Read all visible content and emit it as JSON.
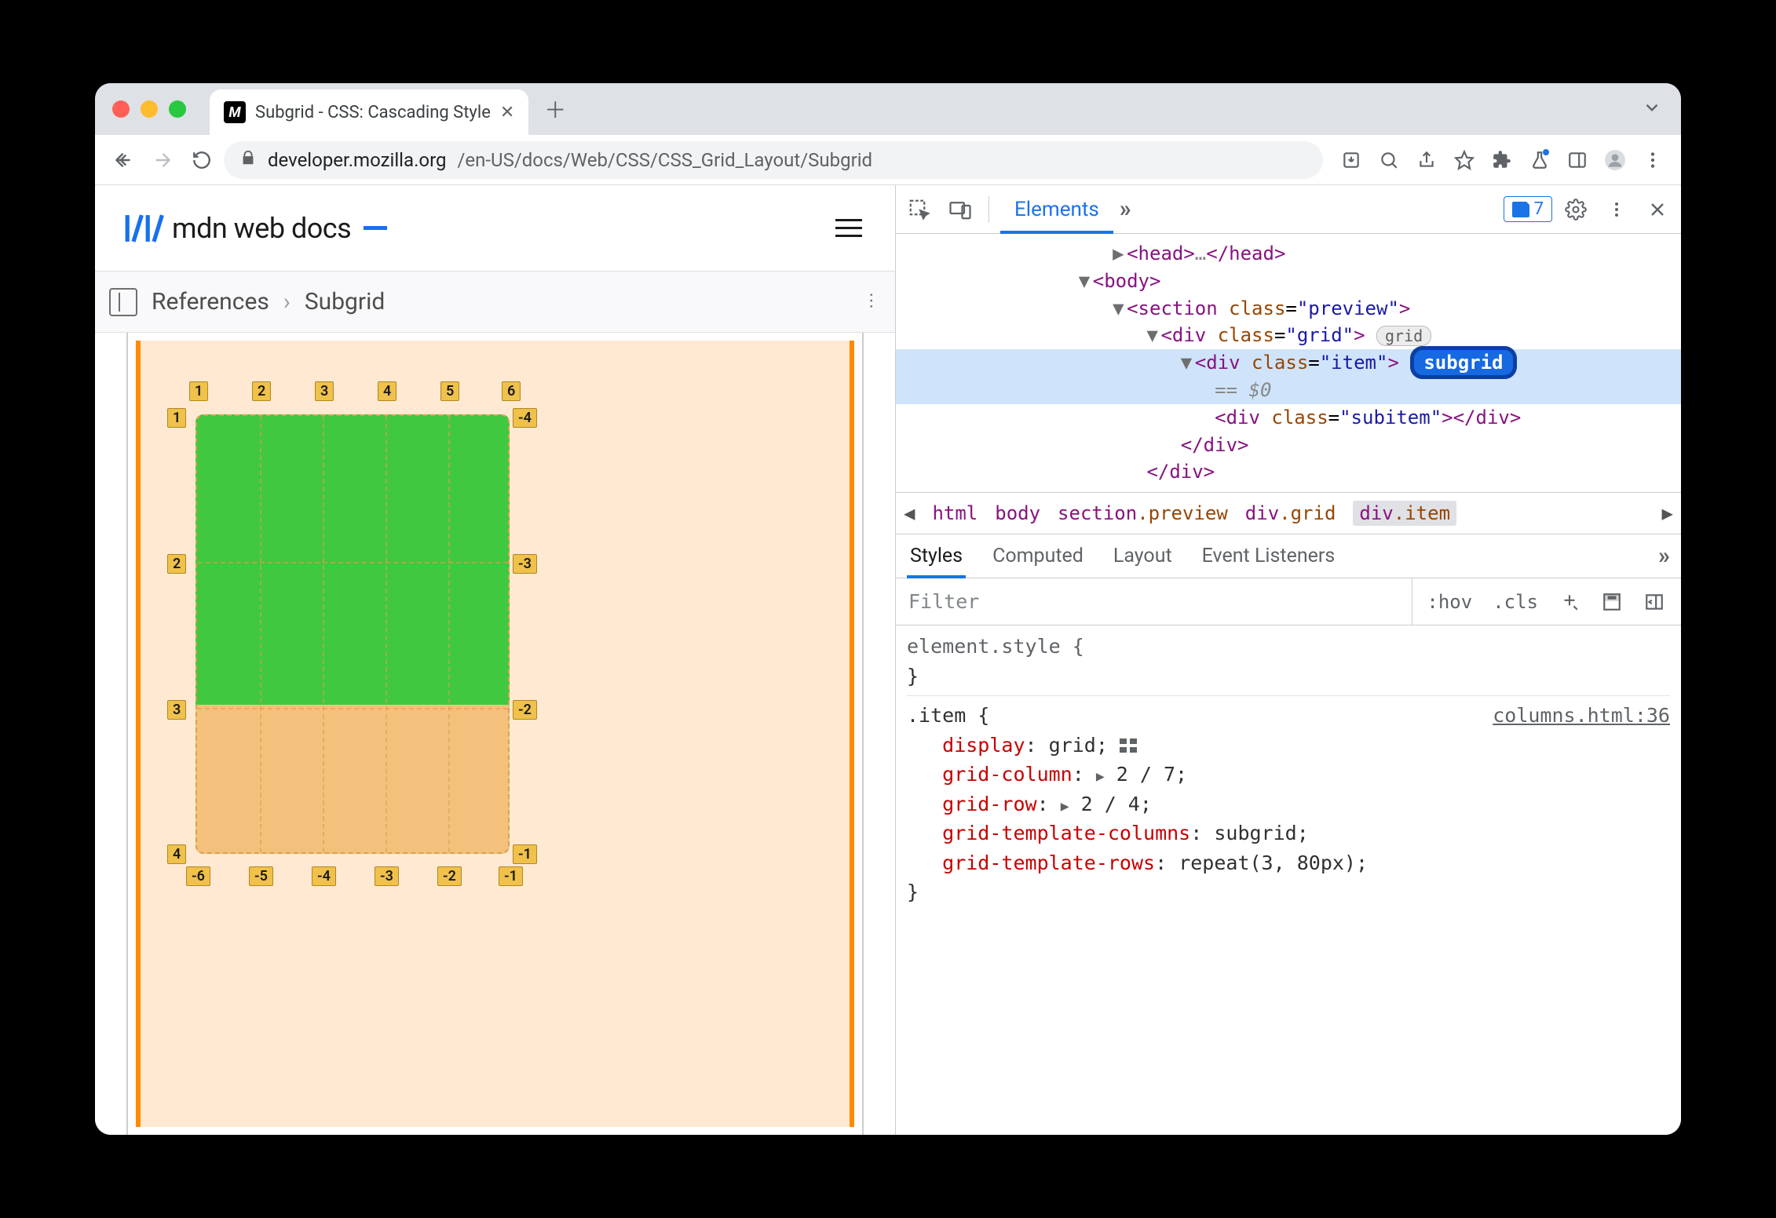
{
  "tab": {
    "title": "Subgrid - CSS: Cascading Style"
  },
  "url": {
    "host": "developer.mozilla.org",
    "path": "/en-US/docs/Web/CSS/CSS_Grid_Layout/Subgrid"
  },
  "issues_count": "7",
  "mdn": {
    "brand": "mdn web docs"
  },
  "breadcrumb": {
    "root": "References",
    "current": "Subgrid"
  },
  "grid_labels": {
    "top": [
      "1",
      "2",
      "3",
      "4",
      "5",
      "6"
    ],
    "left": [
      "1",
      "2",
      "3",
      "4"
    ],
    "right": [
      "-4",
      "-3",
      "-2",
      "-1"
    ],
    "bottom": [
      "-6",
      "-5",
      "-4",
      "-3",
      "-2",
      "-1"
    ]
  },
  "dom": {
    "head": "<head>",
    "head_ellipsis": "…",
    "head_close": "</head>",
    "body": "<body>",
    "section_open": "<section ",
    "section_class_attr": "class",
    "section_class_val": "\"preview\"",
    "section_gt": ">",
    "grid_open": "<div ",
    "grid_class_val": "\"grid\"",
    "item_open": "<div ",
    "item_class_val": "\"item\"",
    "eq0": "== $0",
    "subitem": "<div class=\"subitem\"></div>",
    "div_close": "</div>",
    "badge_grid": "grid",
    "badge_subgrid": "subgrid"
  },
  "path": {
    "p0": "html",
    "p1": "body",
    "p2s": "section",
    "p2c": ".preview",
    "p3s": "div",
    "p3c": ".grid",
    "p4s": "div",
    "p4c": ".item"
  },
  "styles_tabs": {
    "styles": "Styles",
    "computed": "Computed",
    "layout": "Layout",
    "listeners": "Event Listeners"
  },
  "filter": {
    "placeholder": "Filter",
    "hov": ":hov",
    "cls": ".cls"
  },
  "css": {
    "elstyle": "element.style {",
    "close": "}",
    "item_sel": ".item {",
    "src": "columns.html:36",
    "p1": "display",
    "v1": "grid",
    "p2": "grid-column",
    "v2": "2 / 7",
    "p3": "grid-row",
    "v3": "2 / 4",
    "p4": "grid-template-columns",
    "v4": "subgrid",
    "p5": "grid-template-rows",
    "v5": "repeat(3, 80px)"
  }
}
